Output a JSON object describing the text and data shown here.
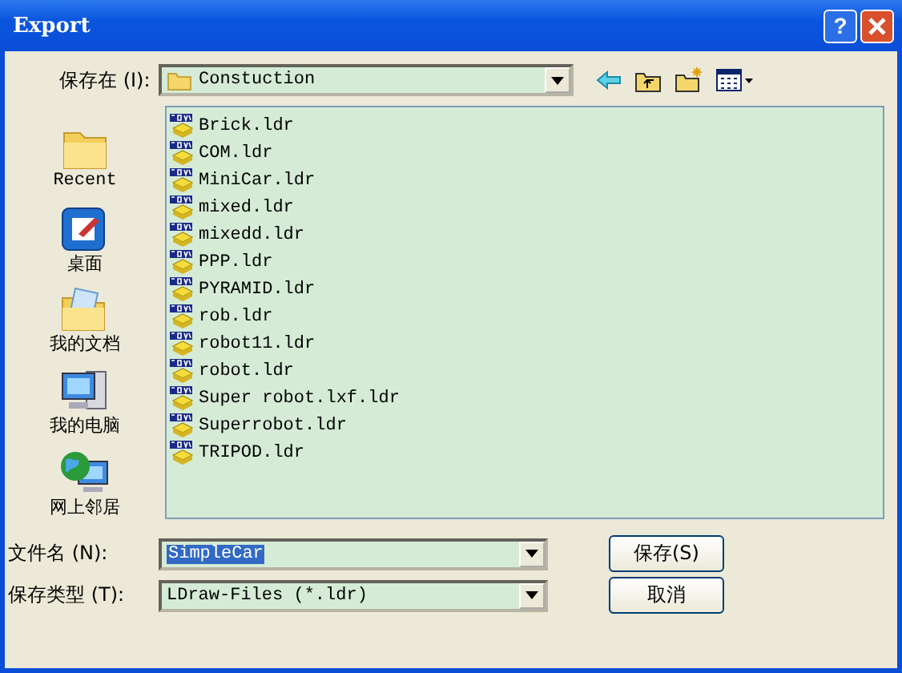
{
  "window": {
    "title": "Export",
    "help": "?"
  },
  "save_in": {
    "label": "保存在 (I):",
    "value": "Constuction"
  },
  "places": [
    {
      "kind": "recent",
      "label": "Recent"
    },
    {
      "kind": "desktop",
      "label": "桌面"
    },
    {
      "kind": "documents",
      "label": "我的文档"
    },
    {
      "kind": "computer",
      "label": "我的电脑"
    },
    {
      "kind": "network",
      "label": "网上邻居"
    }
  ],
  "files": [
    "Brick.ldr",
    "COM.ldr",
    "MiniCar.ldr",
    "mixed.ldr",
    "mixedd.ldr",
    "PPP.ldr",
    "PYRAMID.ldr",
    "rob.ldr",
    "robot11.ldr",
    "robot.ldr",
    "Super robot.lxf.ldr",
    "Superrobot.ldr",
    "TRIPOD.ldr"
  ],
  "file_name": {
    "label": "文件名 (N):",
    "value": "SimpleCar",
    "selected": true
  },
  "file_type": {
    "label": "保存类型 (T):",
    "value": "LDraw-Files (*.ldr)"
  },
  "buttons": [
    "保存(S)",
    "取消"
  ]
}
